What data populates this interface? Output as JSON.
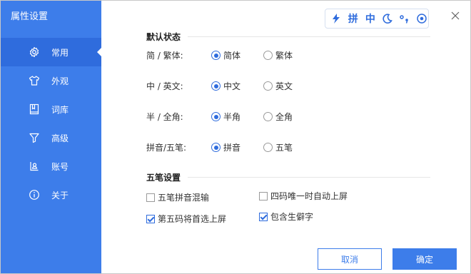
{
  "sidebar": {
    "title": "属性设置",
    "items": [
      {
        "label": "常用",
        "icon": "gear-icon"
      },
      {
        "label": "外观",
        "icon": "shirt-icon"
      },
      {
        "label": "词库",
        "icon": "book-icon"
      },
      {
        "label": "高级",
        "icon": "funnel-icon"
      },
      {
        "label": "账号",
        "icon": "account-card-icon"
      },
      {
        "label": "关于",
        "icon": "info-icon"
      }
    ],
    "active_index": 0
  },
  "toolbar": {
    "pinyin": "拼",
    "zhong": "中"
  },
  "default_state": {
    "title": "默认状态",
    "rows": [
      {
        "label": "简 / 繁体:",
        "options": [
          "简体",
          "繁体"
        ],
        "selected": 0
      },
      {
        "label": "中 / 英文:",
        "options": [
          "中文",
          "英文"
        ],
        "selected": 0
      },
      {
        "label": "半 / 全角:",
        "options": [
          "半角",
          "全角"
        ],
        "selected": 0
      },
      {
        "label": "拼音/五笔:",
        "options": [
          "拼音",
          "五笔"
        ],
        "selected": 0
      }
    ]
  },
  "wubi": {
    "title": "五笔设置",
    "options": [
      {
        "label": "五笔拼音混输",
        "checked": false
      },
      {
        "label": "四码唯一时自动上屏",
        "checked": false
      },
      {
        "label": "第五码将首选上屏",
        "checked": true
      },
      {
        "label": "包含生僻字",
        "checked": true
      }
    ]
  },
  "buttons": {
    "cancel": "取消",
    "ok": "确定"
  },
  "colors": {
    "accent": "#3d7dea",
    "sidebar_active": "#2f6cdd"
  }
}
